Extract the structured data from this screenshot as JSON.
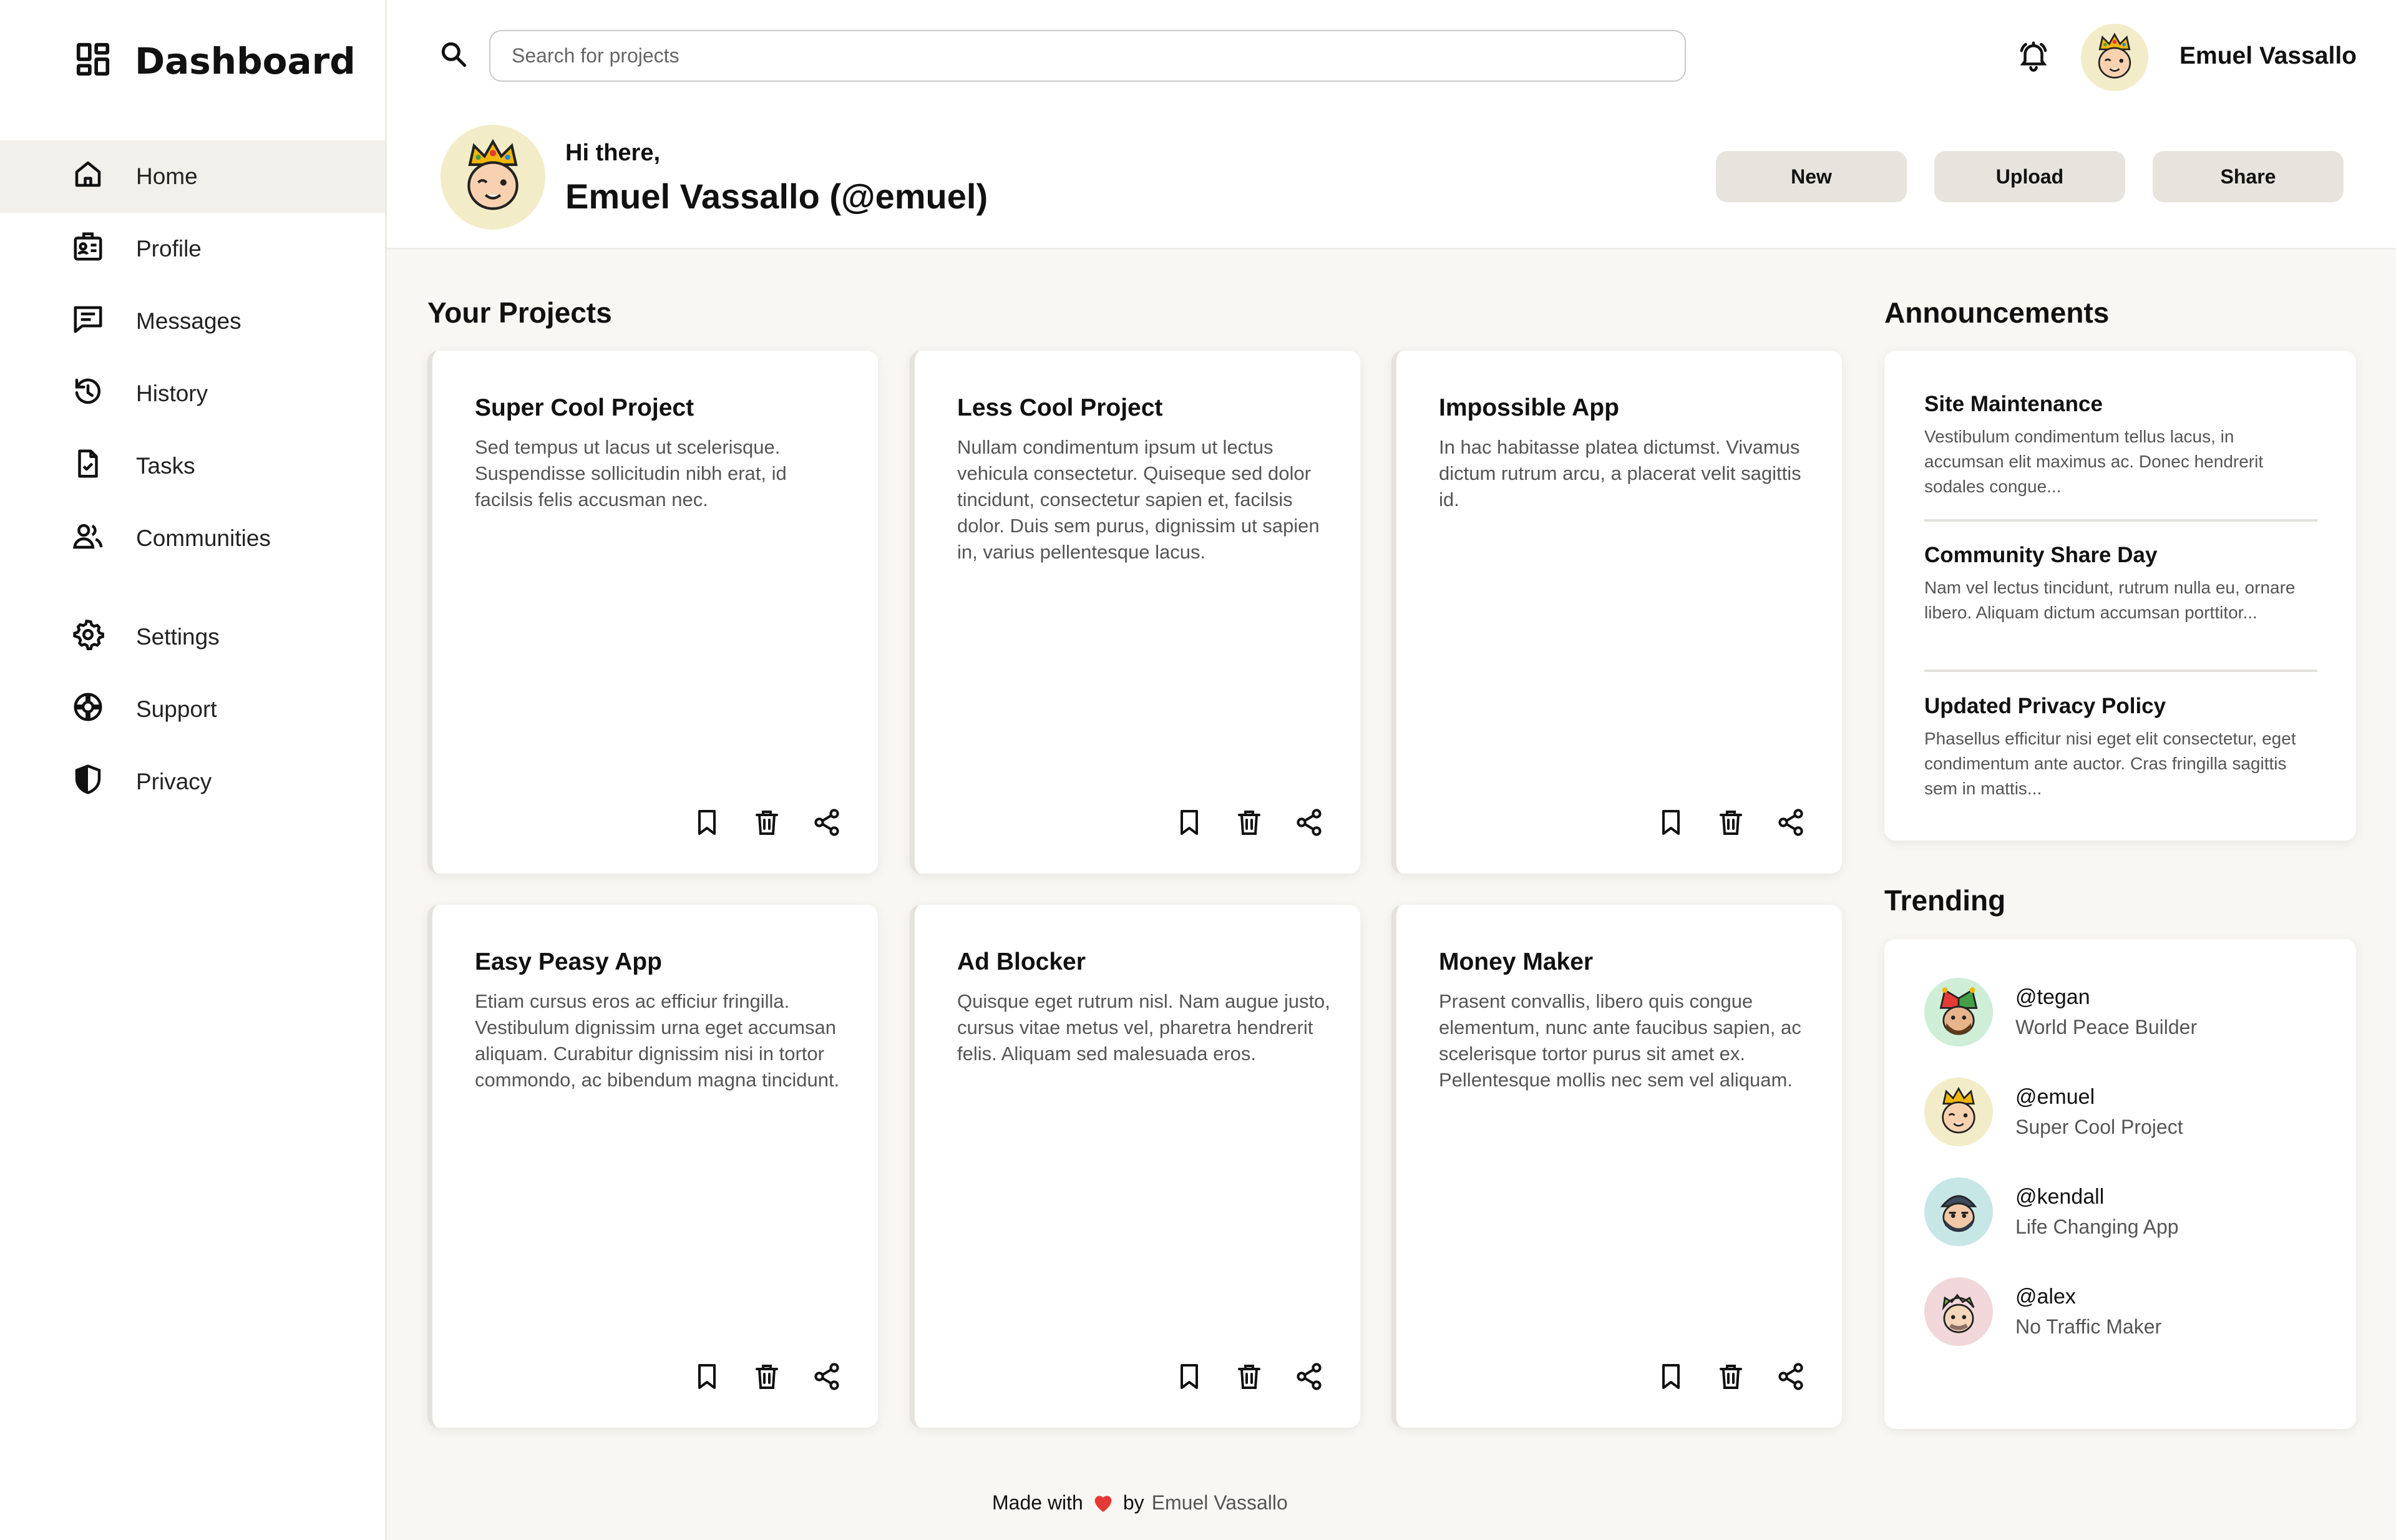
{
  "app": {
    "title": "Dashboard",
    "logo_icon": "dashboard-grid-icon"
  },
  "sidebar": {
    "items": [
      {
        "label": "Home",
        "icon": "home-icon",
        "active": true
      },
      {
        "label": "Profile",
        "icon": "id-card-icon"
      },
      {
        "label": "Messages",
        "icon": "message-icon"
      },
      {
        "label": "History",
        "icon": "history-icon"
      },
      {
        "label": "Tasks",
        "icon": "task-file-icon"
      },
      {
        "label": "Communities",
        "icon": "users-icon"
      }
    ],
    "secondary": [
      {
        "label": "Settings",
        "icon": "gear-icon"
      },
      {
        "label": "Support",
        "icon": "lifebuoy-icon"
      },
      {
        "label": "Privacy",
        "icon": "shield-icon"
      }
    ]
  },
  "header": {
    "search_placeholder": "Search for projects",
    "user_name": "Emuel Vassallo",
    "greeting": "Hi there,",
    "greeting_name": "Emuel Vassallo (@emuel)",
    "buttons": {
      "new": "New",
      "upload": "Upload",
      "share": "Share"
    }
  },
  "projects": {
    "title": "Your Projects",
    "items": [
      {
        "title": "Super Cool Project",
        "desc": "Sed tempus ut lacus ut scelerisque. Suspendisse sollicitudin nibh erat, id facilsis felis accusman nec."
      },
      {
        "title": "Less Cool Project",
        "desc": "Nullam condimentum ipsum ut lectus vehicula consectetur. Quiseque sed dolor tincidunt, consectetur sapien et, facilsis dolor. Duis sem purus, dignissim ut sapien in, varius pellentesque lacus."
      },
      {
        "title": "Impossible App",
        "desc": "In hac habitasse platea dictumst. Vivamus dictum rutrum arcu, a placerat velit sagittis id."
      },
      {
        "title": "Easy Peasy App",
        "desc": "Etiam cursus eros ac efficiur fringilla. Vestibulum dignissim urna eget accumsan aliquam. Curabitur dignissim nisi in tortor commondo, ac bibendum magna tincidunt."
      },
      {
        "title": "Ad Blocker",
        "desc": "Quisque eget rutrum nisl. Nam augue justo, cursus vitae metus vel, pharetra hendrerit felis. Aliquam sed malesuada eros."
      },
      {
        "title": "Money Maker",
        "desc": "Prasent convallis, libero quis congue elementum, nunc ante faucibus sapien, ac scelerisque tortor purus sit amet ex. Pellentesque mollis nec sem vel aliquam."
      }
    ]
  },
  "announcements": {
    "title": "Announcements",
    "items": [
      {
        "title": "Site Maintenance",
        "text": "Vestibulum condimentum tellus lacus, in accumsan elit maximus ac. Donec hendrerit sodales congue..."
      },
      {
        "title": "Community Share Day",
        "text": "Nam vel lectus tincidunt, rutrum nulla eu, ornare libero. Aliquam dictum accumsan porttitor..."
      },
      {
        "title": "Updated Privacy Policy",
        "text": "Phasellus efficitur nisi eget elit consectetur, eget condimentum ante auctor. Cras fringilla sagittis sem in mattis..."
      }
    ]
  },
  "trending": {
    "title": "Trending",
    "items": [
      {
        "handle": "@tegan",
        "sub": "World Peace Builder",
        "color": "#cfeed7"
      },
      {
        "handle": "@emuel",
        "sub": "Super Cool Project",
        "color": "#f3ecc8"
      },
      {
        "handle": "@kendall",
        "sub": "Life Changing App",
        "color": "#c7e7e7"
      },
      {
        "handle": "@alex",
        "sub": "No Traffic Maker",
        "color": "#f1d7da"
      }
    ]
  },
  "footer": {
    "made_with": "Made with",
    "by": "by",
    "author": "Emuel Vassallo"
  },
  "colors": {
    "accent_bg": "#f1f0ea",
    "button_bg": "#e6e4dc",
    "heart": "#e53935"
  }
}
